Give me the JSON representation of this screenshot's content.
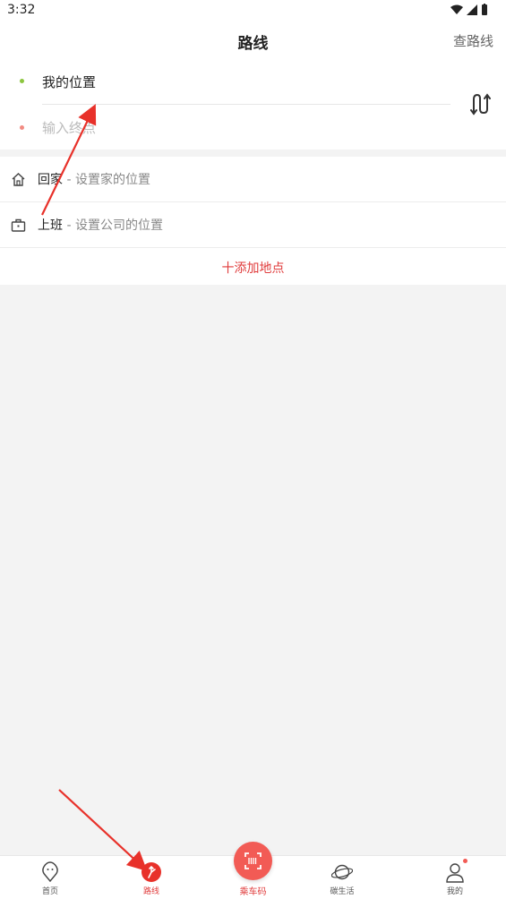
{
  "status_bar": {
    "time": "3:32"
  },
  "header": {
    "title": "路线",
    "action_label": "查路线"
  },
  "route": {
    "start_label": "我的位置",
    "end_placeholder": "输入终点"
  },
  "places": [
    {
      "name": "回家",
      "hint": " - 设置家的位置",
      "icon": "home-icon"
    },
    {
      "name": "上班",
      "hint": " - 设置公司的位置",
      "icon": "briefcase-icon"
    }
  ],
  "add_place_label": "十添加地点",
  "tabbar": {
    "tabs": [
      {
        "label": "首页",
        "icon": "home-pin-icon"
      },
      {
        "label": "路线",
        "icon": "route-icon",
        "active": true
      },
      {
        "label": "乘车码",
        "icon": "qr-scan-icon"
      },
      {
        "label": "碳生活",
        "icon": "planet-icon"
      },
      {
        "label": "我的",
        "icon": "user-icon"
      }
    ]
  },
  "colors": {
    "accent": "#e03c3c",
    "start_dot": "#8cc63f",
    "end_dot": "#f28b82",
    "annotation_arrow": "#e8312a"
  }
}
